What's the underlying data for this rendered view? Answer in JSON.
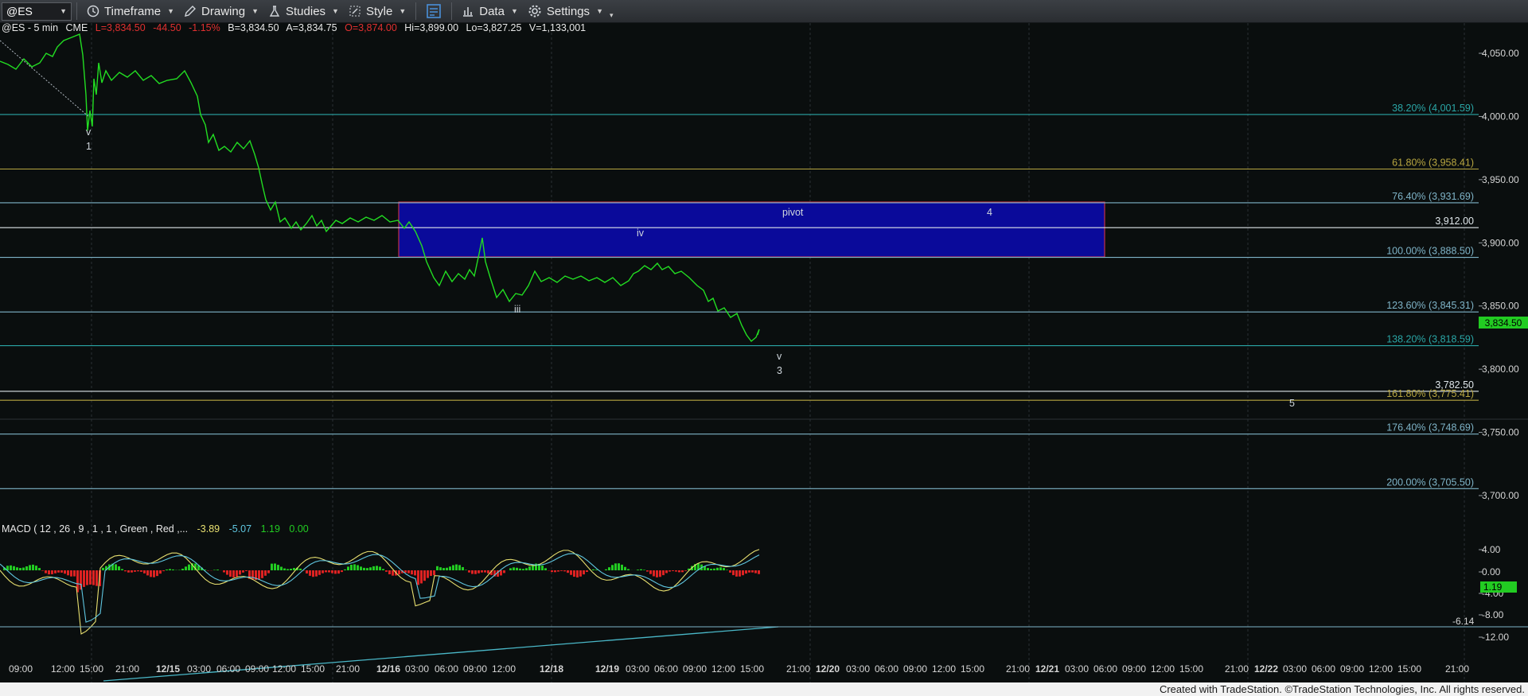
{
  "toolbar": {
    "symbol": "@ES",
    "timeframe": "Timeframe",
    "drawing": "Drawing",
    "studies": "Studies",
    "style": "Style",
    "data": "Data",
    "settings": "Settings"
  },
  "status_line": {
    "instrument": "@ES - 5 min",
    "exchange": "CME",
    "last": "L=3,834.50",
    "net_change": "-44.50",
    "pct_change": "-1.15%",
    "bid": "B=3,834.50",
    "ask": "A=3,834.75",
    "open": "O=3,874.00",
    "high": "Hi=3,899.00",
    "low": "Lo=3,827.25",
    "volume": "V=1,133,001"
  },
  "fib_levels": [
    {
      "label": "38.20% (4,001.59)",
      "price": 4001.59,
      "color": "#2aa6a6"
    },
    {
      "label": "61.80% (3,958.41)",
      "price": 3958.41,
      "color": "#b8a640"
    },
    {
      "label": "76.40% (3,931.69)",
      "price": 3931.69,
      "color": "#7fb4c8"
    },
    {
      "label": "3,912.00",
      "price": 3912.0,
      "color": "#dfe6ea"
    },
    {
      "label": "100.00% (3,888.50)",
      "price": 3888.5,
      "color": "#7fb4c8"
    },
    {
      "label": "123.60% (3,845.31)",
      "price": 3845.31,
      "color": "#7fb4c8"
    },
    {
      "label": "138.20% (3,818.59)",
      "price": 3818.59,
      "color": "#2aa6a6"
    },
    {
      "label": "3,782.50",
      "price": 3782.5,
      "color": "#dfe6ea"
    },
    {
      "label": "161.80% (3,775.41)",
      "price": 3775.41,
      "color": "#b8a640"
    },
    {
      "label": "176.40% (3,748.69)",
      "price": 3748.69,
      "color": "#7fb4c8"
    },
    {
      "label": "200.00% (3,705.50)",
      "price": 3705.5,
      "color": "#7fb4c8"
    }
  ],
  "wave_labels": {
    "v1_top": "v",
    "v1_bottom": "1",
    "iii": "iii",
    "iv": "iv",
    "pivot": "pivot",
    "w4": "4",
    "v3_top": "v",
    "v3_bottom": "3",
    "w5": "5"
  },
  "price_axis": {
    "ticks": [
      "4,050.00",
      "4,000.00",
      "3,950.00",
      "3,900.00",
      "3,850.00",
      "3,800.00",
      "3,750.00",
      "3,700.00"
    ],
    "last_price": "3,834.50"
  },
  "macd": {
    "title": "MACD ( 12 , 26 , 9 , 1 , 1 , Green , Red ,...",
    "macd_value": "-3.89",
    "signal_value": "-5.07",
    "hist_value": "1.19",
    "zero_value": "0.00",
    "axis_ticks": [
      "4.00",
      "0.00",
      "-4.00",
      "-8.00",
      "-12.00"
    ],
    "current_hist": "1.19",
    "trendline_value": "-6.14"
  },
  "time_axis": [
    "09:00",
    "12:00",
    "15:00",
    "21:00",
    "12/15",
    "03:00",
    "06:00",
    "09:00",
    "12:00",
    "15:00",
    "21:00",
    "12/16",
    "03:00",
    "06:00",
    "09:00",
    "12:00",
    "12/18",
    "12/19",
    "03:00",
    "06:00",
    "09:00",
    "12:00",
    "15:00",
    "21:00",
    "12/20",
    "03:00",
    "06:00",
    "09:00",
    "12:00",
    "15:00",
    "21:00",
    "12/21",
    "03:00",
    "06:00",
    "09:00",
    "12:00",
    "15:00",
    "21:00",
    "12/22",
    "03:00",
    "06:00",
    "09:00",
    "12:00",
    "15:00",
    "21:00"
  ],
  "credit": "Created with TradeStation. ©TradeStation Technologies, Inc. All rights reserved.",
  "colors": {
    "price_line": "#22dd22",
    "pivot_box_fill": "#0a0a9a",
    "pivot_box_border": "#c0304a",
    "macd_line": "#e8e070",
    "signal_line": "#5fc6e0",
    "hist_up": "#22cc22",
    "hist_down": "#dd2222",
    "trendline": "#4ab8c8",
    "last_price_tag": "#22cc22"
  }
}
